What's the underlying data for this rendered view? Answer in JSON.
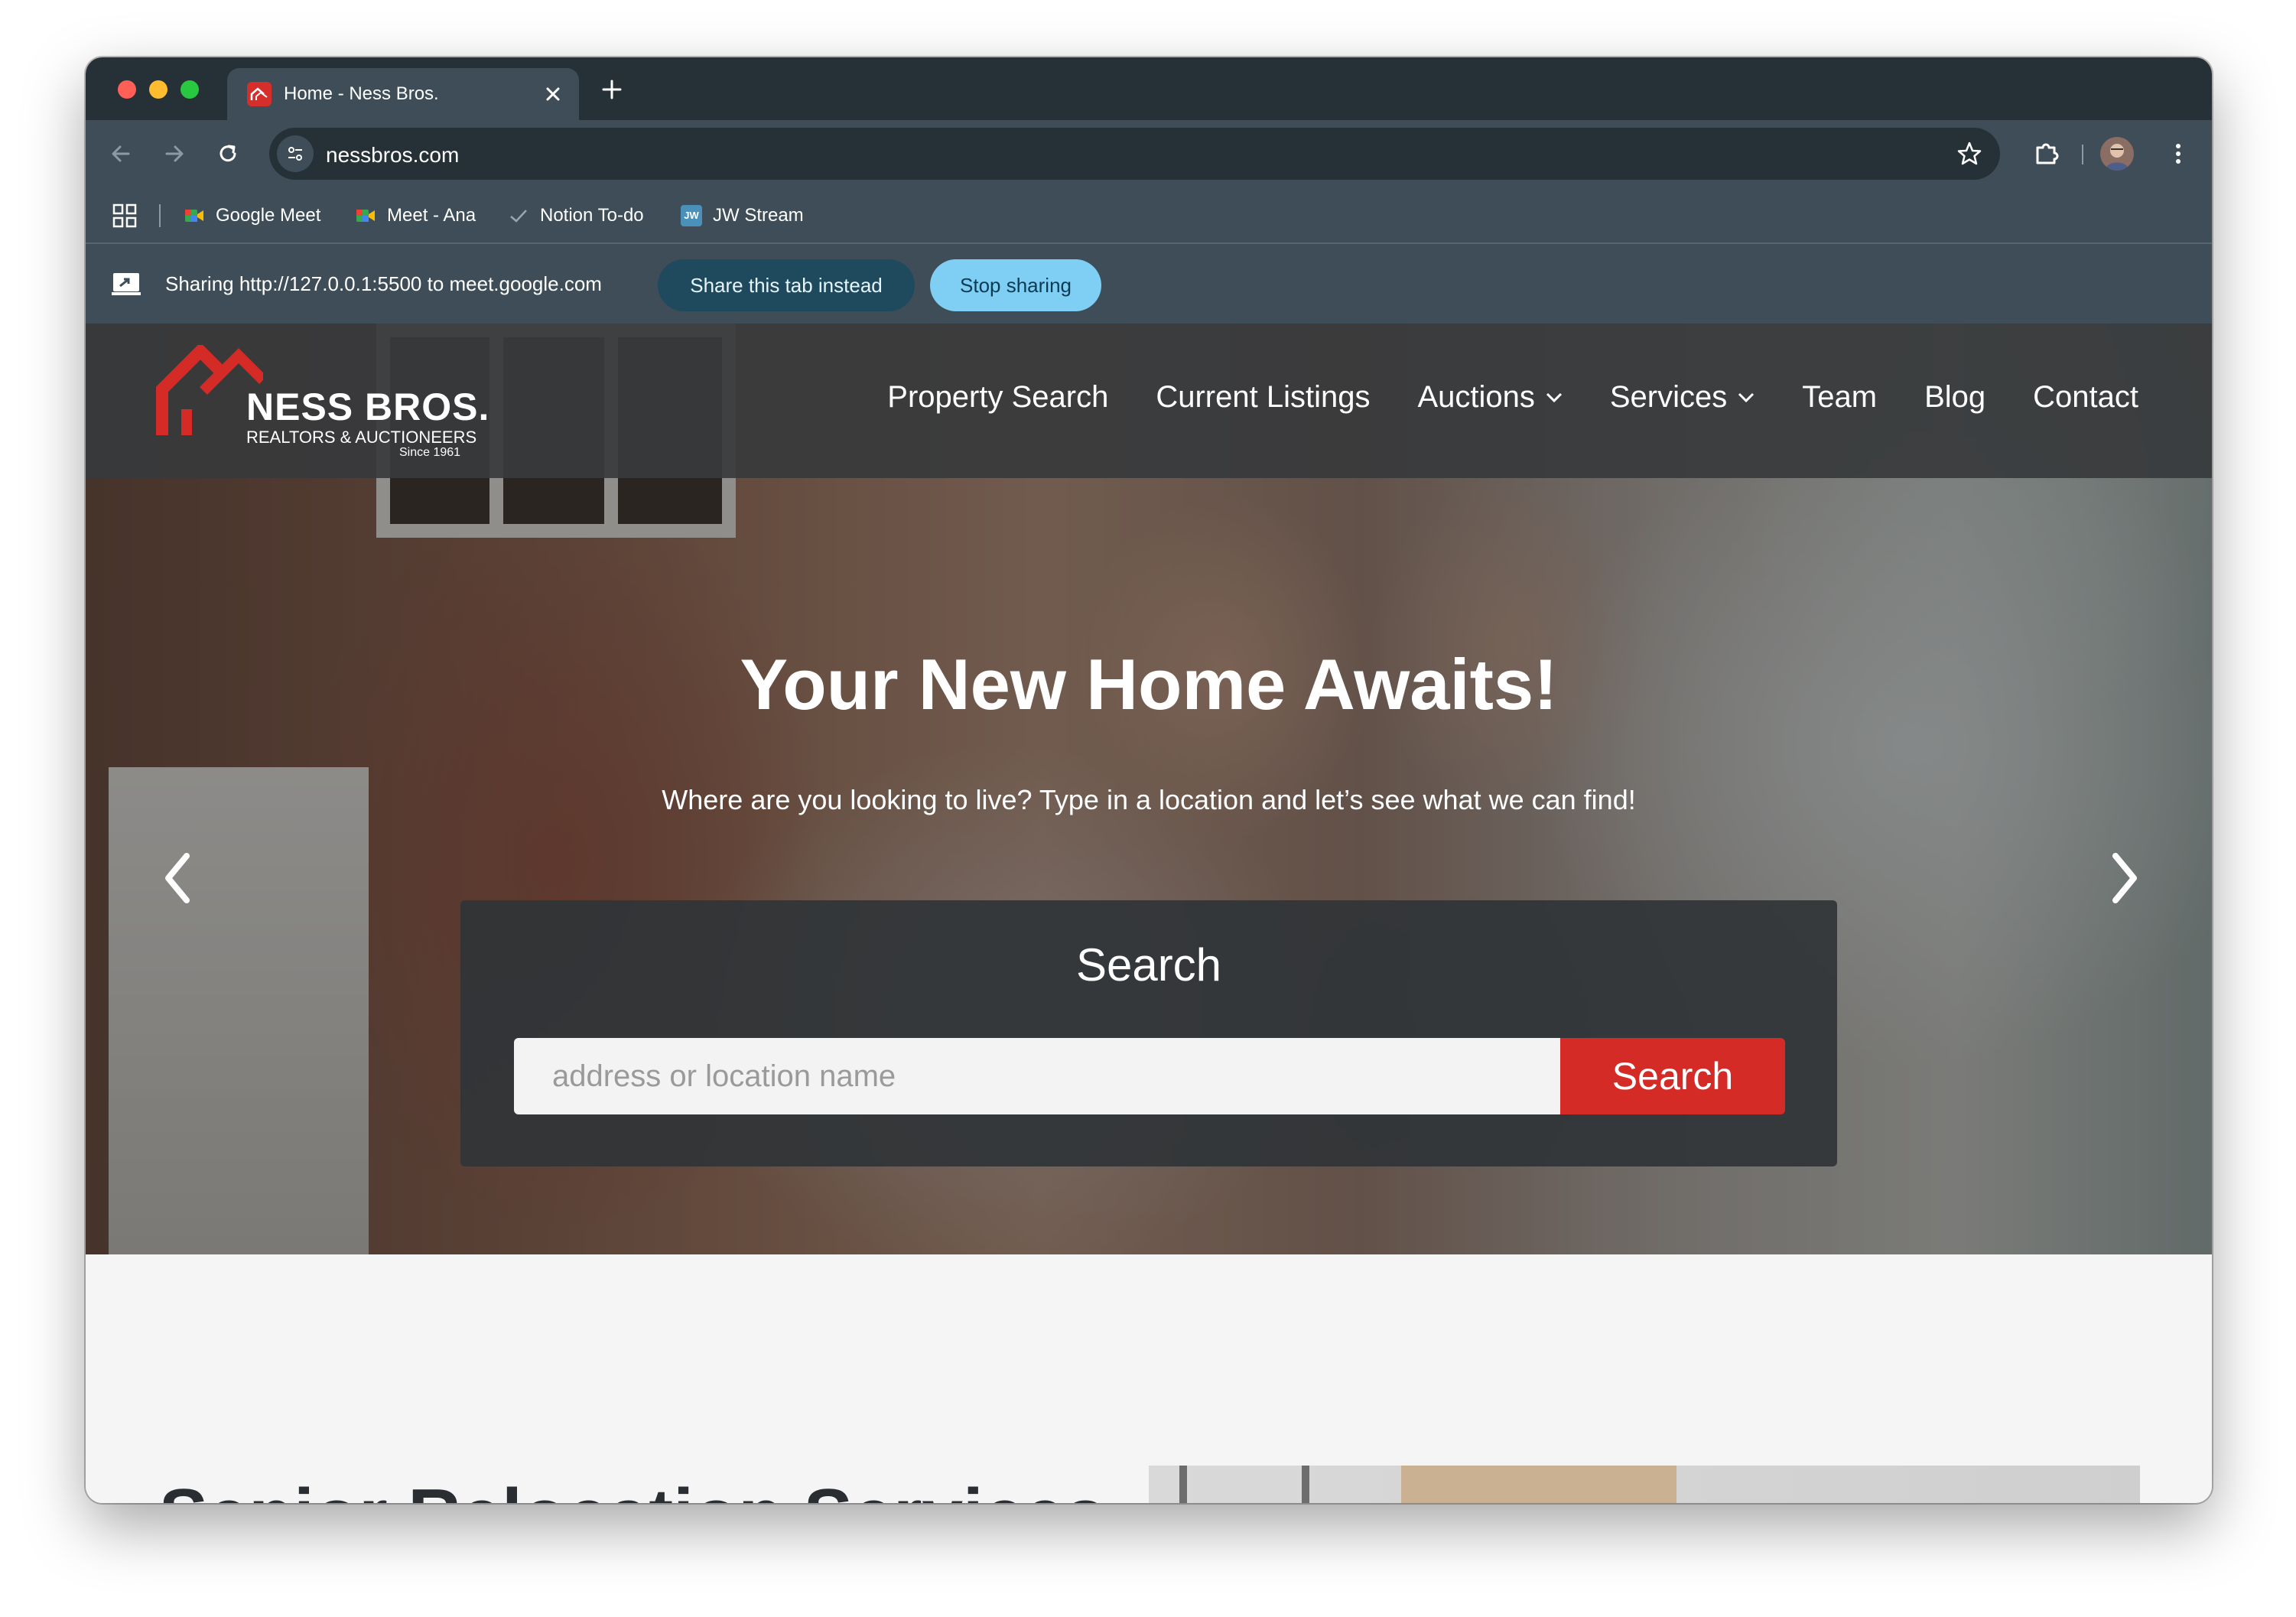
{
  "browser": {
    "tab": {
      "title": "Home - Ness Bros."
    },
    "address_bar": {
      "url": "nessbros.com"
    },
    "bookmarks": [
      {
        "label": "Google Meet",
        "icon": "google-meet-icon"
      },
      {
        "label": "Meet - Ana",
        "icon": "google-meet-icon"
      },
      {
        "label": "Notion To-do",
        "icon": "check-icon"
      },
      {
        "label": "JW Stream",
        "icon": "jw-icon",
        "icon_text": "JW"
      }
    ],
    "sharing_bar": {
      "text": "Sharing http://127.0.0.1:5500 to meet.google.com",
      "share_tab_label": "Share this tab instead",
      "stop_label": "Stop sharing"
    }
  },
  "site": {
    "logo": {
      "title": "NESS BROS.",
      "subtitle": "REALTORS & AUCTIONEERS",
      "since": "Since 1961"
    },
    "nav": [
      {
        "label": "Property Search",
        "dropdown": false
      },
      {
        "label": "Current Listings",
        "dropdown": false
      },
      {
        "label": "Auctions",
        "dropdown": true
      },
      {
        "label": "Services",
        "dropdown": true
      },
      {
        "label": "Team",
        "dropdown": false
      },
      {
        "label": "Blog",
        "dropdown": false
      },
      {
        "label": "Contact",
        "dropdown": false
      }
    ],
    "hero": {
      "title": "Your New Home Awaits!",
      "subtitle": "Where are you looking to live? Type in a location and let’s see what we can find!"
    },
    "search": {
      "heading": "Search",
      "placeholder": "address or location name",
      "value": "",
      "button_label": "Search"
    },
    "section": {
      "title": "Senior Relocation Services"
    }
  },
  "colors": {
    "brand_red": "#d52b27",
    "browser_dark": "#263037",
    "browser_toolbar": "#3e4d57",
    "stop_sharing": "#7fcff5",
    "share_tab": "#1f4a5e"
  }
}
